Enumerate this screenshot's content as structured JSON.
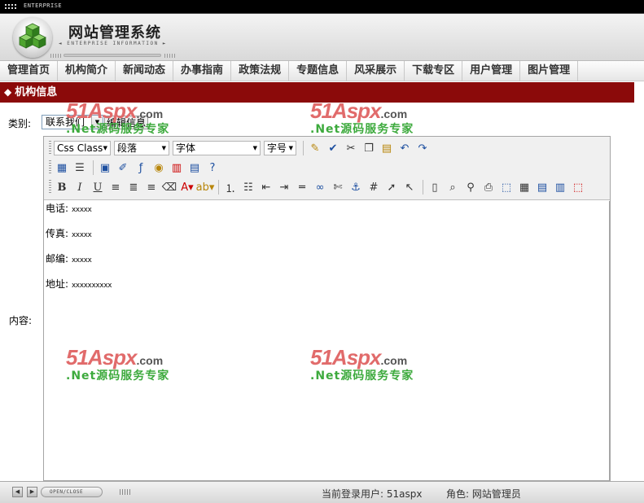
{
  "header": {
    "strip_label": "ENTERPRISE",
    "title": "网站管理系统",
    "subtitle": "◄ ENTERPRISE INFORMATION ►"
  },
  "nav": {
    "items": [
      "管理首页",
      "机构简介",
      "新闻动态",
      "办事指南",
      "政策法规",
      "专题信息",
      "风采展示",
      "下载专区",
      "用户管理",
      "图片管理"
    ]
  },
  "section": {
    "icon": "◆",
    "title": "机构信息"
  },
  "form": {
    "category_label": "类别:",
    "category_value": "联系我们",
    "edit_button": "编辑信息",
    "content_label": "内容:"
  },
  "editor": {
    "css_class": "Css Class",
    "paragraph": "段落",
    "font": "字体",
    "font_size": "字号",
    "lines": [
      {
        "label": "电话:",
        "value": "xxxxx"
      },
      {
        "label": "传真:",
        "value": "xxxxx"
      },
      {
        "label": "邮编:",
        "value": "xxxxx"
      },
      {
        "label": "地址:",
        "value": "xxxxxxxxxx"
      }
    ]
  },
  "watermark": {
    "brand": "51Aspx",
    "domain": ".com",
    "tagline": ".Net源码服务专家"
  },
  "footer": {
    "toggle": "OPEN/CLOSE",
    "user_label": "当前登录用户: 51aspx",
    "role_label": "角色: 网站管理员"
  },
  "colors": {
    "section_bar": "#8b0a0a",
    "watermark_red": "#e16b6b",
    "watermark_green": "#3daa3d"
  },
  "icons": [
    "grid-icon",
    "logo-cubes-icon",
    "arrow-left-icon",
    "arrow-right-icon"
  ]
}
